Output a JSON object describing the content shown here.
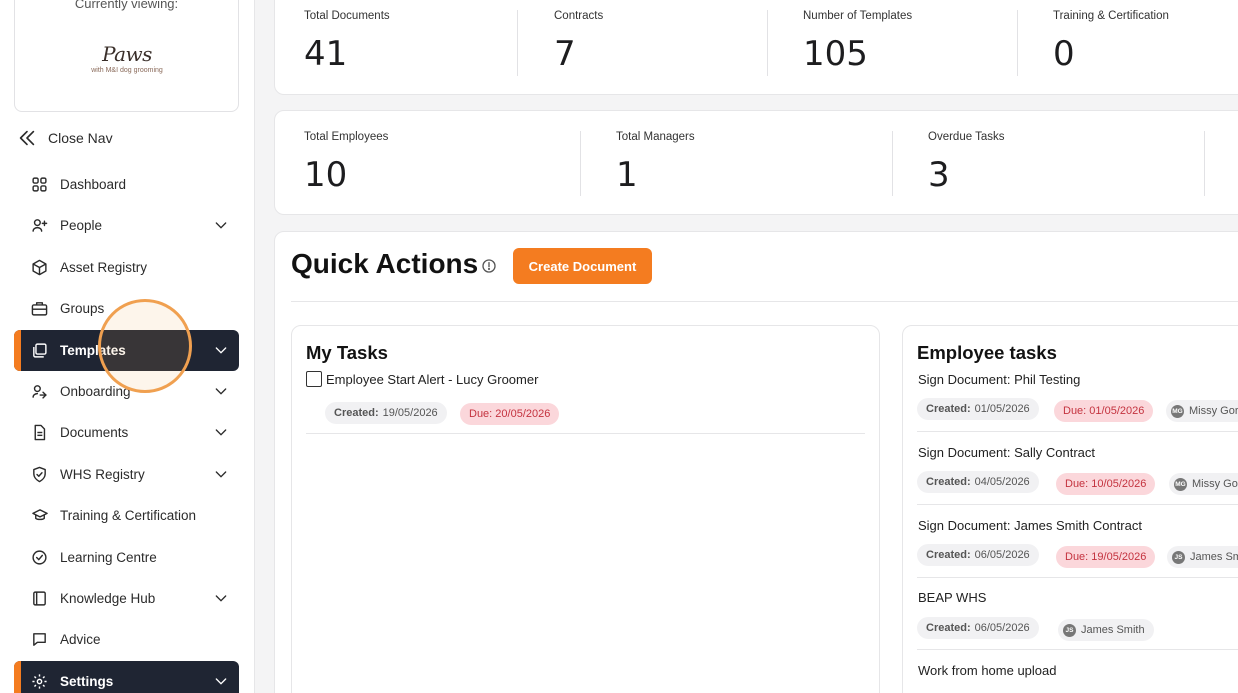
{
  "sidebar": {
    "viewing_label": "Currently viewing:",
    "logo_text": "Paws",
    "logo_sub": "with M&I dog grooming",
    "close_nav": "Close Nav",
    "items": [
      {
        "label": "Dashboard",
        "icon": "grid-icon"
      },
      {
        "label": "People",
        "icon": "user-plus-icon"
      },
      {
        "label": "Asset Registry",
        "icon": "cube-icon"
      },
      {
        "label": "Groups",
        "icon": "briefcase-icon"
      },
      {
        "label": "Templates",
        "icon": "copy-icon"
      },
      {
        "label": "Onboarding",
        "icon": "user-arrow-icon"
      },
      {
        "label": "Documents",
        "icon": "document-icon"
      },
      {
        "label": "WHS Registry",
        "icon": "shield-check-icon"
      },
      {
        "label": "Training & Certification",
        "icon": "graduation-cap-icon"
      },
      {
        "label": "Learning Centre",
        "icon": "check-circle-icon"
      },
      {
        "label": "Knowledge Hub",
        "icon": "book-icon"
      },
      {
        "label": "Advice",
        "icon": "chat-icon"
      },
      {
        "label": "Settings",
        "icon": "gear-icon"
      }
    ]
  },
  "stats_top": [
    {
      "label": "Total Documents",
      "value": "41"
    },
    {
      "label": "Contracts",
      "value": "7"
    },
    {
      "label": "Number of Templates",
      "value": "105"
    },
    {
      "label": "Training & Certification",
      "value": "0"
    }
  ],
  "stats_bottom": [
    {
      "label": "Total Employees",
      "value": "10"
    },
    {
      "label": "Total Managers",
      "value": "1"
    },
    {
      "label": "Overdue Tasks",
      "value": "3"
    }
  ],
  "quick_actions": {
    "title": "Quick Actions",
    "create_button": "Create Document"
  },
  "my_tasks": {
    "title": "My Tasks",
    "tasks": [
      {
        "name": "Employee Start Alert - Lucy Groomer",
        "created_label": "Created:",
        "created": "19/05/2026",
        "due": "Due: 20/05/2026"
      }
    ]
  },
  "employee_tasks": {
    "title": "Employee tasks",
    "tasks": [
      {
        "name": "Sign Document: Phil Testing",
        "created_label": "Created:",
        "created": "01/05/2026",
        "due": "Due: 01/05/2026",
        "initials": "MG",
        "person": "Missy Gor"
      },
      {
        "name": "Sign Document: Sally Contract",
        "created_label": "Created:",
        "created": "04/05/2026",
        "due": "Due: 10/05/2026",
        "initials": "MG",
        "person": "Missy Gor"
      },
      {
        "name": "Sign Document: James Smith Contract",
        "created_label": "Created:",
        "created": "06/05/2026",
        "due": "Due: 19/05/2026",
        "initials": "JS",
        "person": "James Sm"
      },
      {
        "name": "BEAP WHS",
        "created_label": "Created:",
        "created": "06/05/2026",
        "initials": "JS",
        "person": "James Smith"
      },
      {
        "name": "Work from home upload"
      }
    ]
  },
  "colors": {
    "accent": "#f47c20",
    "active_nav": "#1f2533",
    "due_bg": "#fbd7db",
    "due_text": "#c4333f"
  }
}
